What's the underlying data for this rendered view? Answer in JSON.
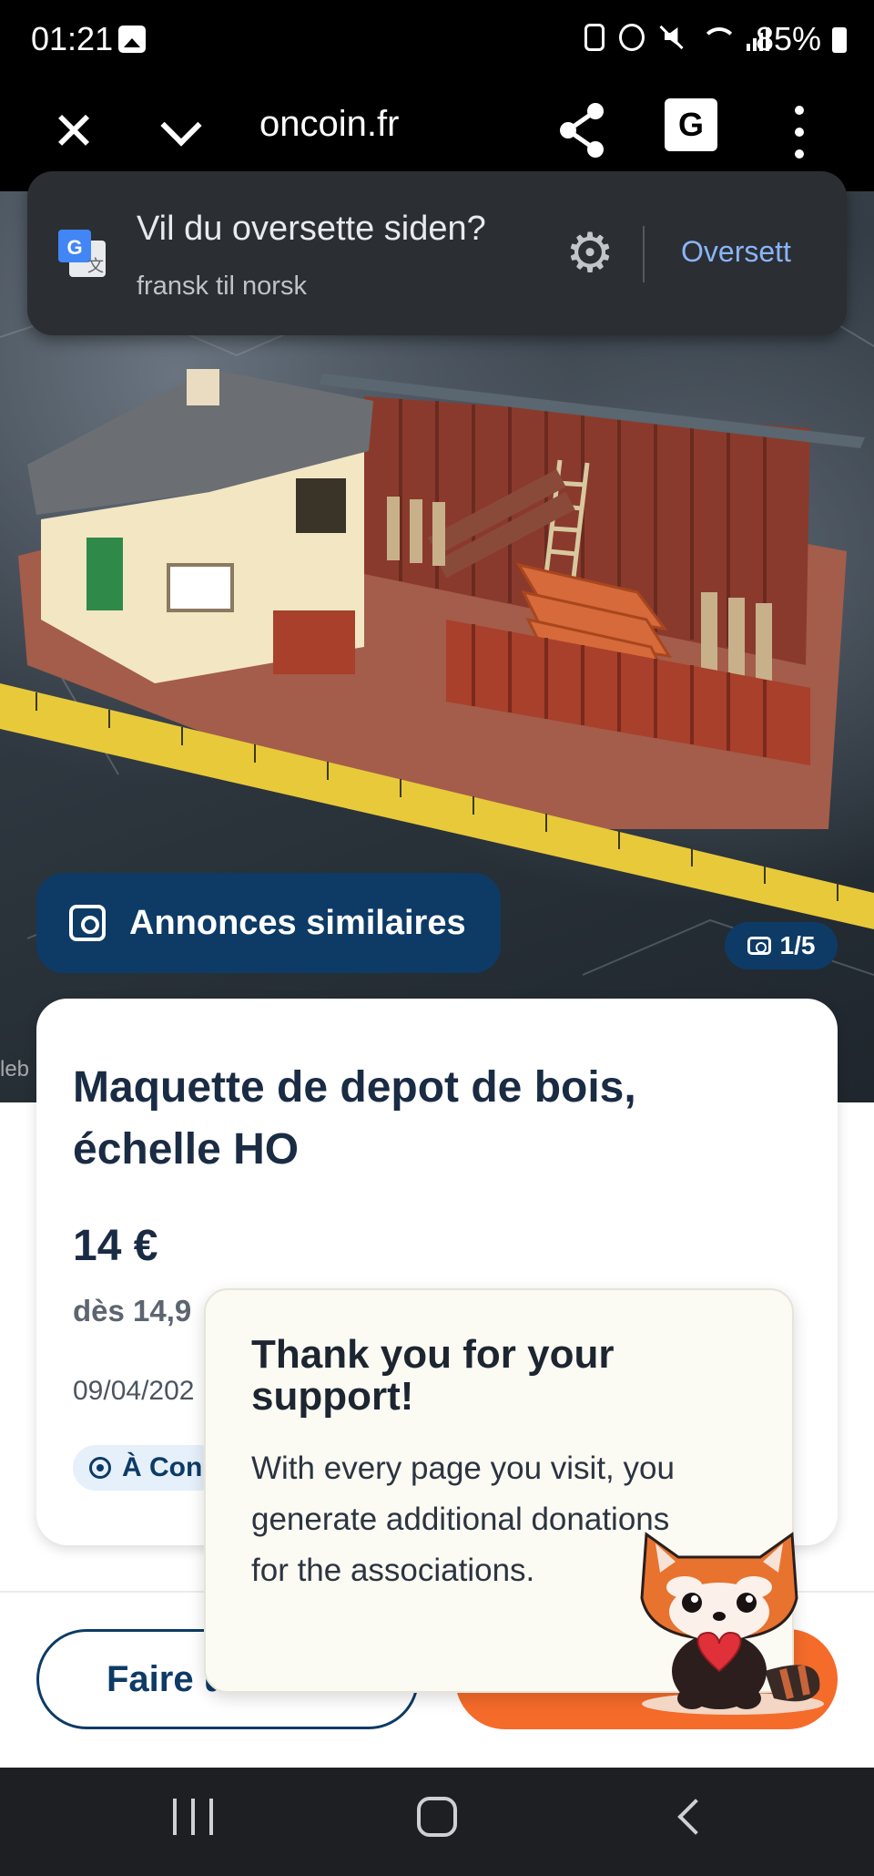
{
  "status_bar": {
    "time": "01:21",
    "battery": "85%"
  },
  "browser": {
    "url": "oncoin.fr",
    "translate_glyph": "G文"
  },
  "translate_banner": {
    "title": "Vil du oversette siden?",
    "subtitle": "fransk til norsk",
    "button": "Oversett"
  },
  "gallery": {
    "similar_label": "Annonces similaires",
    "counter": "1/5",
    "watermark": "leb"
  },
  "ad": {
    "title": "Maquette de depot de bois, échelle HO",
    "price": "14 €",
    "shipping": "dès 14,9",
    "date": "09/04/202",
    "location": "À Con"
  },
  "actions": {
    "offer": "Faire u",
    "buy": ""
  },
  "popup": {
    "title": "Thank you for your support!",
    "body": "With every page you visit, you generate additional donations for the associations."
  },
  "colors": {
    "brand": "#0d3b66",
    "accent": "#f56b2a",
    "link": "#8ab4f8"
  }
}
